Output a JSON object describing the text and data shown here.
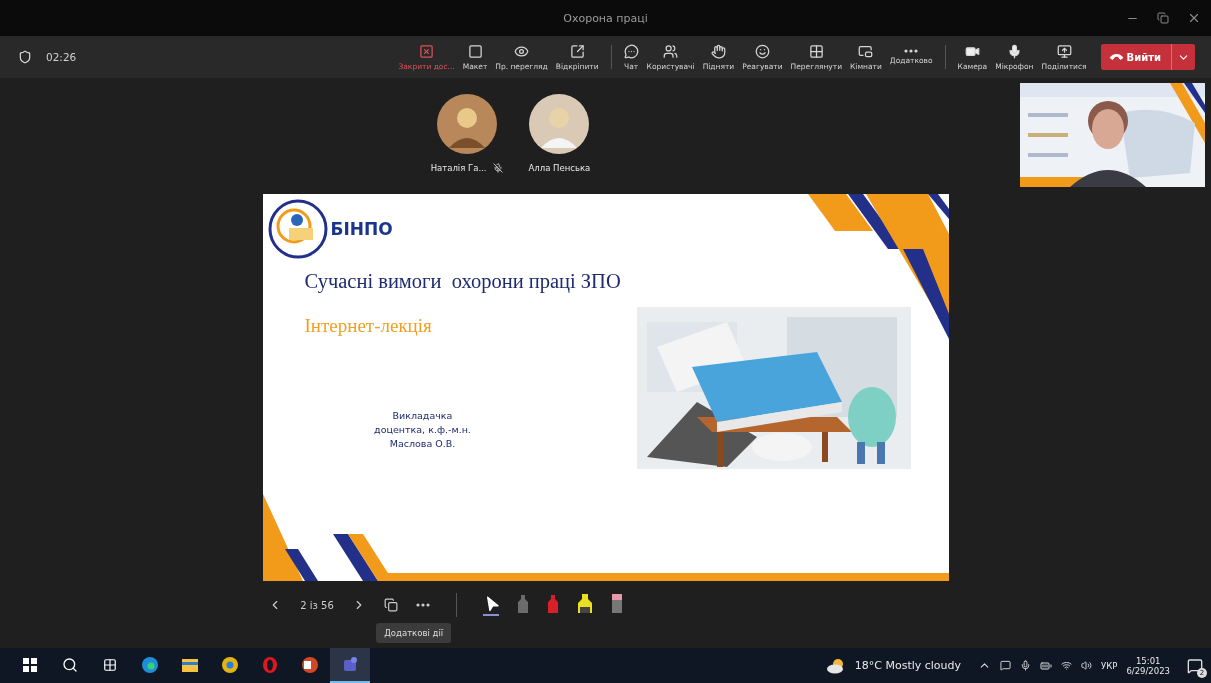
{
  "window": {
    "title": "Охорона праці"
  },
  "meeting": {
    "timer": "02:26"
  },
  "share_controls": [
    {
      "label": "Закрити дос...",
      "danger": true
    },
    {
      "label": "Макет",
      "danger": false
    },
    {
      "label": "Пр. перегляд",
      "danger": false
    },
    {
      "label": "Відкріпити",
      "danger": false
    }
  ],
  "meeting_controls": [
    {
      "label": "Чат"
    },
    {
      "label": "Користувачі"
    },
    {
      "label": "Підняти"
    },
    {
      "label": "Реагувати"
    },
    {
      "label": "Переглянути"
    },
    {
      "label": "Кімнати"
    },
    {
      "label": "Додатково"
    }
  ],
  "device_controls": [
    {
      "label": "Камера"
    },
    {
      "label": "Мікрофон"
    },
    {
      "label": "Поділитися"
    }
  ],
  "leave_button": {
    "label": "Вийти"
  },
  "participants": [
    {
      "name": "Наталія Га...",
      "muted": true
    },
    {
      "name": "Алла Пенська",
      "muted": false
    }
  ],
  "slide": {
    "logo_text": "БІНПО",
    "title": "Сучасні вимоги  охорони праці ЗПО",
    "subtitle": "Інтернет-лекція",
    "author_lines": [
      "Викладачка",
      "доцентка, к.ф.-м.н.",
      "Маслова О.В."
    ]
  },
  "presentation_controls": {
    "page": "2 із 56",
    "tooltip": "Додаткові дії",
    "tools": [
      {
        "kind": "pointer",
        "selected": true
      },
      {
        "kind": "pen",
        "color": "#6b6b6b",
        "selected": false
      },
      {
        "kind": "pen",
        "color": "#d8202a",
        "selected": false
      },
      {
        "kind": "highlighter",
        "color": "#e8e020",
        "selected": false
      },
      {
        "kind": "eraser",
        "color": "#e89aa8",
        "selected": false
      }
    ]
  },
  "taskbar": {
    "apps": [
      {
        "selected": false
      },
      {
        "selected": false
      },
      {
        "selected": false
      },
      {
        "selected": false
      },
      {
        "selected": false
      },
      {
        "selected": true
      }
    ],
    "weather": "18°C Mostly cloudy",
    "language": "УКР",
    "time": "15:01",
    "date": "6/29/2023",
    "notifications": "2"
  }
}
